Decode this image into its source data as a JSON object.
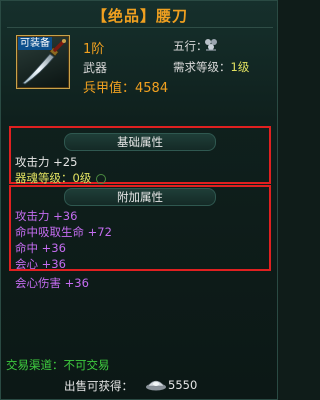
{
  "header": {
    "title": "【绝品】腰刀"
  },
  "item": {
    "badge": "可装备",
    "tier": "1阶",
    "type": "武器",
    "power_label": "兵甲值：",
    "power_value": "4584",
    "wuxing_label": "五行：",
    "wuxing_icon": "five-elements-icon",
    "req_label": "需求等级：",
    "req_value": "1级"
  },
  "base_section": {
    "title": "基础属性",
    "attack": "攻击力  +25",
    "soul_level": "器魂等级：0级"
  },
  "extra_section": {
    "title": "附加属性",
    "lines": [
      "攻击力  +36",
      "命中吸取生命  +72",
      "命中  +36",
      "会心  +36",
      "会心伤害  +36"
    ]
  },
  "footer": {
    "trade": "交易渠道：不可交易",
    "sell_label": "出售可获得：",
    "sell_value": "5550",
    "currency_icon": "silver-ingot-icon"
  },
  "colors": {
    "gold": "#f0a020",
    "purple": "#c46cf0",
    "green": "#3fcf3f",
    "highlight_red": "#e02020"
  }
}
